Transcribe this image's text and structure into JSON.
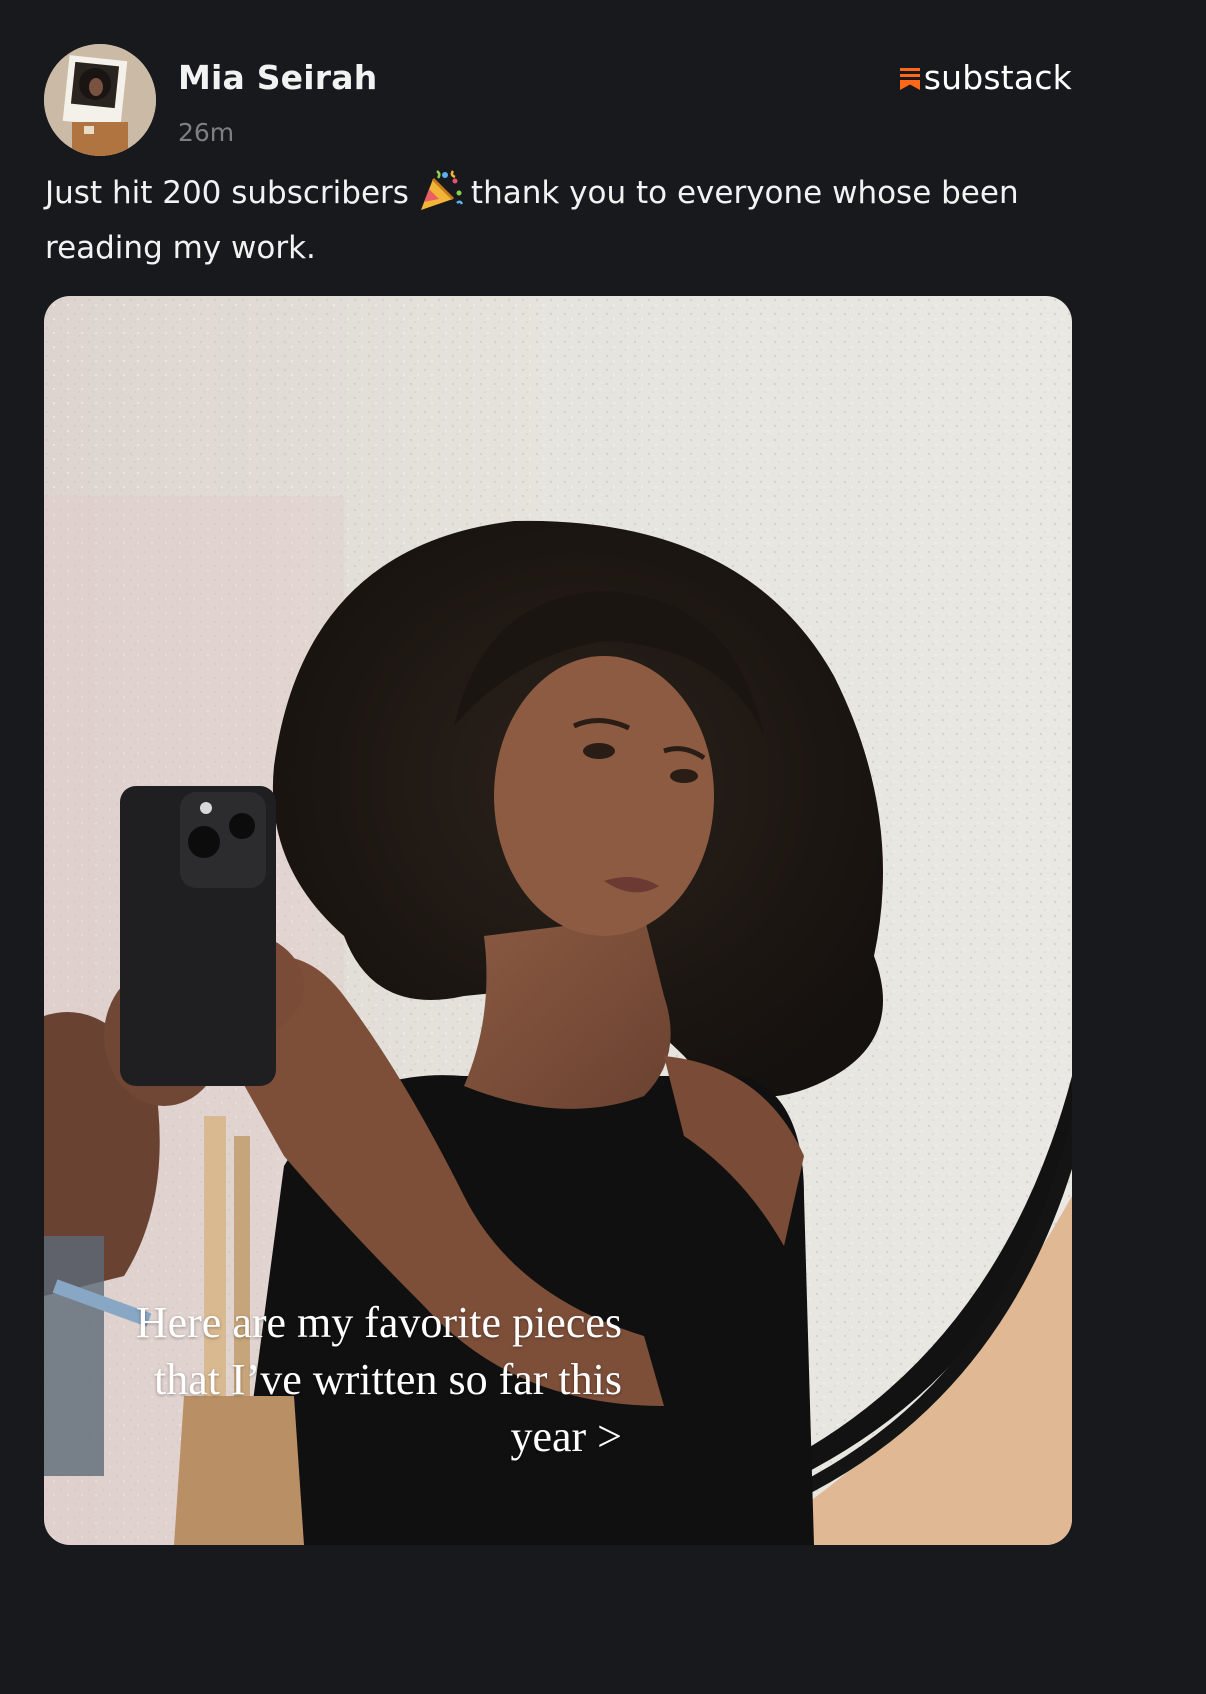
{
  "post": {
    "author": "Mia Seirah",
    "timestamp": "26m",
    "brand": "substack",
    "text_before_emoji": "Just hit 200 subscribers",
    "text_after_emoji": "thank you to everyone whose been reading my work.",
    "emoji": "party-popper-icon",
    "media": {
      "caption": "Here are my favorite pieces that I’ve written so far this year >"
    }
  },
  "colors": {
    "background": "#17191c",
    "brand_accent": "#ff6719",
    "secondary_text": "#7c7f84"
  }
}
